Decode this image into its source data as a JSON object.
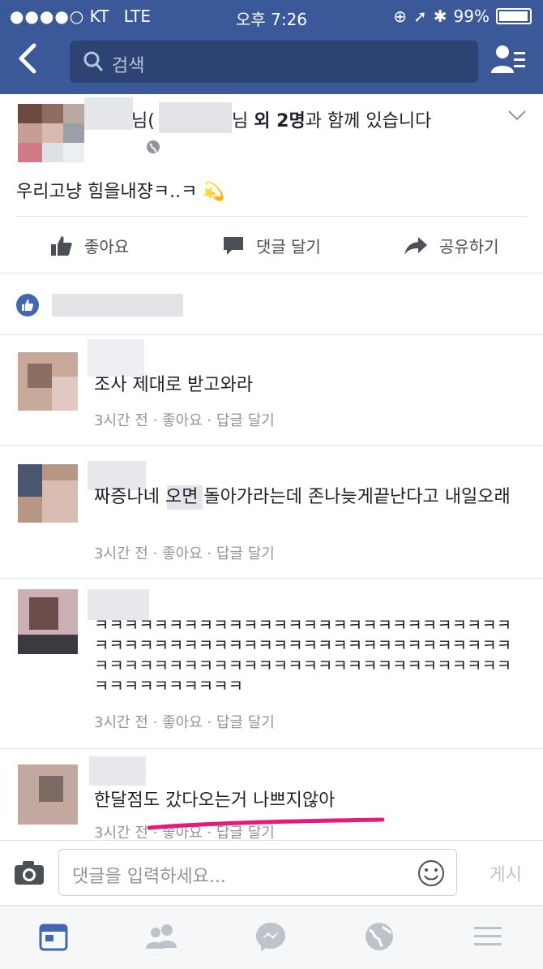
{
  "status_bar": {
    "carrier": "KT",
    "network": "LTE",
    "time": "오후 7:26",
    "battery": "99%"
  },
  "search": {
    "placeholder": "검색"
  },
  "post": {
    "header_name_tail": "님",
    "header_with": "외 2명",
    "header_suffix": "과 함께 있습니다",
    "text": "우리고냥 힘을내쟝ㅋ..ㅋ 💫",
    "actions": {
      "like": "좋아요",
      "comment": "댓글 달기",
      "share": "공유하기"
    }
  },
  "comments": [
    {
      "text": "조사 제대로 받고와라",
      "meta": "3시간 전 · 좋아요 · 답글 달기"
    },
    {
      "text": "짜증나네 오면 돌아가라는데 존나늦게끝난다고 내일오래",
      "meta": "3시간 전 · 좋아요 · 답글 달기"
    },
    {
      "text": "ㅋㅋㅋㅋㅋㅋㅋㅋㅋㅋㅋㅋㅋㅋㅋㅋㅋㅋㅋㅋㅋㅋㅋㅋㅋㅋㅋㅋㅋㅋㅋㅋㅋㅋㅋㅋㅋㅋㅋㅋㅋㅋㅋㅋㅋㅋㅋㅋㅋㅋㅋㅋㅋㅋㅋㅋㅋㅋㅋㅋㅋㅋㅋㅋㅋㅋㅋㅋㅋㅋㅋㅋㅋㅋㅋㅋㅋㅋㅋㅋㅋㅋㅋㅋㅋㅋㅋㅋㅋㅋㅋㅋㅋㅋ",
      "meta": "3시간 전 · 좋아요 · 답글 달기"
    },
    {
      "text": "한달점도 갔다오는거 나쁘지않아",
      "meta": "3시간 전 · 좋아요 · 답글 달기"
    }
  ],
  "composer": {
    "placeholder": "댓글을 입력하세요...",
    "post_label": "게시"
  },
  "tabs": [
    "news-feed-icon",
    "friends-icon",
    "messenger-icon",
    "notifications-globe-icon",
    "menu-icon"
  ],
  "colors": {
    "brand": "#3b5998",
    "underline": "#e8197a"
  }
}
